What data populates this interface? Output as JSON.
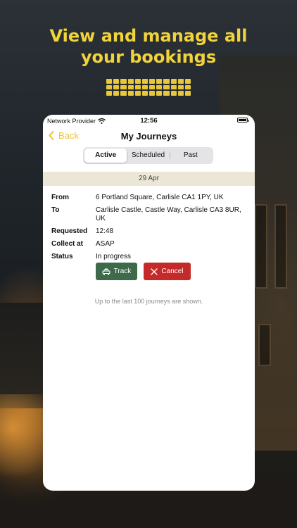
{
  "promo": {
    "headline_line1": "View and manage all",
    "headline_line2": "your bookings",
    "accent_color": "#f1d33a"
  },
  "status_bar": {
    "provider": "Network Provider",
    "time": "12:56"
  },
  "nav": {
    "back_label": "Back",
    "title": "My Journeys"
  },
  "tabs": [
    {
      "label": "Active",
      "selected": true
    },
    {
      "label": "Scheduled",
      "selected": false
    },
    {
      "label": "Past",
      "selected": false
    }
  ],
  "journey": {
    "date": "29 Apr",
    "fields": [
      {
        "label": "From",
        "value": "6 Portland Square, Carlisle CA1 1PY, UK"
      },
      {
        "label": "To",
        "value": "Carlisle Castle, Castle Way, Carlisle CA3 8UR, UK"
      },
      {
        "label": "Requested",
        "value": "12:48"
      },
      {
        "label": "Collect at",
        "value": "ASAP"
      },
      {
        "label": "Status",
        "value": "In progress"
      }
    ],
    "actions": {
      "track_label": "Track",
      "cancel_label": "Cancel"
    }
  },
  "footnote": "Up to the last 100 journeys are shown.",
  "colors": {
    "back_accent": "#e8c23a",
    "track_button": "#3d6b4a",
    "cancel_button": "#c42a29",
    "date_band": "#ece6d6"
  }
}
